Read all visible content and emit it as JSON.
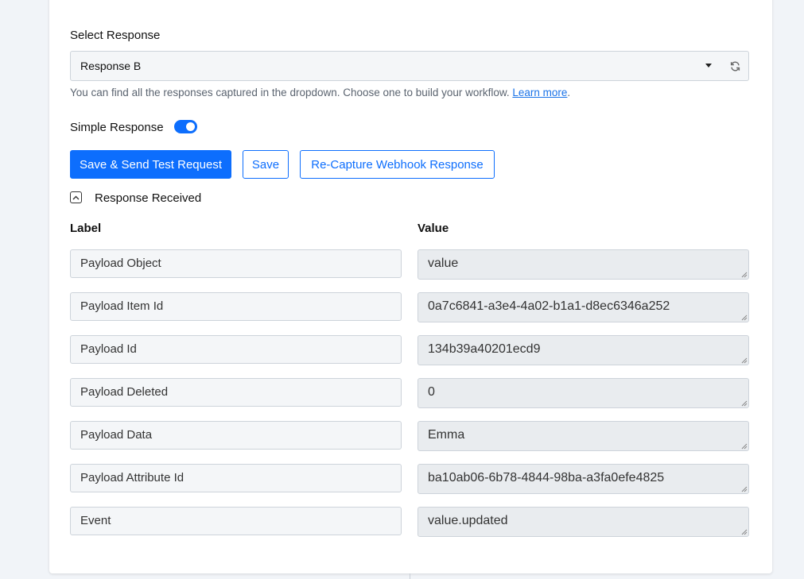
{
  "select_response": {
    "label": "Select Response",
    "selected": "Response B",
    "help_text": "You can find all the responses captured in the dropdown. Choose one to build your workflow.",
    "help_link": "Learn more",
    "help_suffix": "."
  },
  "simple_response": {
    "label": "Simple Response",
    "enabled": true
  },
  "buttons": {
    "save_send": "Save & Send Test Request",
    "save": "Save",
    "recapture": "Re-Capture Webhook Response"
  },
  "response_received": {
    "title": "Response Received",
    "expanded": true
  },
  "table": {
    "label_header": "Label",
    "value_header": "Value",
    "rows": [
      {
        "label": "Payload Object",
        "value": "value"
      },
      {
        "label": "Payload Item Id",
        "value": "0a7c6841-a3e4-4a02-b1a1-d8ec6346a252"
      },
      {
        "label": "Payload Id",
        "value": "134b39a40201ecd9"
      },
      {
        "label": "Payload Deleted",
        "value": "0"
      },
      {
        "label": "Payload Data",
        "value": "Emma"
      },
      {
        "label": "Payload Attribute Id",
        "value": "ba10ab06-6b78-4844-98ba-a3fa0efe4825"
      },
      {
        "label": "Event",
        "value": "value.updated"
      }
    ]
  },
  "colors": {
    "primary": "#0d6efd",
    "link": "#1a73e8",
    "field_bg": "#f4f6f8",
    "readonly_bg": "#e9ecef",
    "page_bg": "#f1f4f8"
  },
  "icons": {
    "refresh": "refresh-icon",
    "caret": "caret-down-icon",
    "collapse": "chevron-up-icon",
    "resize": "resize-grip-icon"
  }
}
